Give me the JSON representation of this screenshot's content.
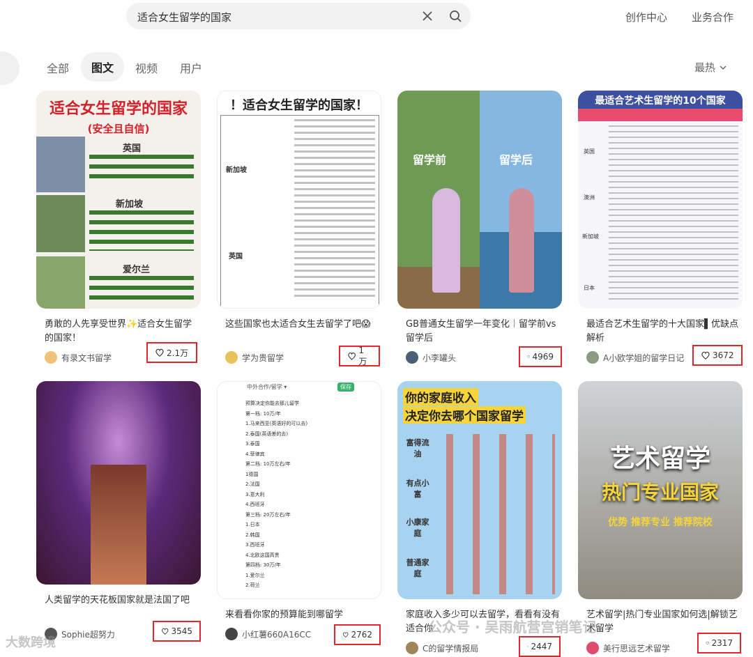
{
  "header": {
    "search_query": "适合女生留学的国家",
    "links": [
      "创作中心",
      "业务合作"
    ]
  },
  "tabs": [
    {
      "label": "全部",
      "active": false
    },
    {
      "label": "图文",
      "active": true
    },
    {
      "label": "视频",
      "active": false
    },
    {
      "label": "用户",
      "active": false
    }
  ],
  "sort_label": "最热",
  "cards": [
    {
      "thumb": {
        "headline": "适合女生留学的国家",
        "sub": "(安全且自信)",
        "sections": [
          "英国",
          "新加坡",
          "爱尔兰"
        ]
      },
      "title": "勇敢的人先享受世界✨适合女生留学的国家！",
      "author": "有录文书留学",
      "likes": "2.1万"
    },
    {
      "thumb": {
        "headline": "！适合女生留学的国家！",
        "rows": [
          "新加坡",
          "英国"
        ]
      },
      "title": "这些国家也太适合女生去留学了吧😱",
      "author": "学为贵留学",
      "likes": "1万"
    },
    {
      "thumb": {
        "left": "留学前",
        "right": "留学后"
      },
      "title": "GB普通女生留学一年变化｜留学前vs留学后",
      "author": "小李罐头",
      "likes": "4969"
    },
    {
      "thumb": {
        "headline": "最适合艺术生留学的10个国家",
        "countries": [
          "英国",
          "澳洲",
          "新加坡",
          "日本"
        ]
      },
      "title": "最适合艺术生留学的十大国家▌优缺点解析",
      "author": "A小欧学姐的留学日记",
      "likes": "3672"
    },
    {
      "thumb": {},
      "title": "人类留学的天花板国家就是法国了吧",
      "author": "Sophie超努力",
      "likes": "3545"
    },
    {
      "thumb": {
        "header": "中外合作/留学 ▾",
        "badge": "保存",
        "lines": [
          "预算决定你能去那儿留学",
          "第一档: 10万/年",
          "1.马来西亚(英语好的可以去)",
          "2.泰国(英语差的去)",
          "3.泰国",
          "4.菲律宾",
          "第二档: 10万左右/年",
          "1德国",
          "2.法国",
          "3.意大利",
          "4.西班牙",
          "第三档: 20万左右/年",
          "1.日本",
          "2.韩国",
          "3.西班牙",
          "4.北欧这国高贵",
          "第四档: 30万/年",
          "1.爱尔兰",
          "2.荷兰"
        ]
      },
      "title": "来看看你家的预算能到哪留学",
      "author": "小红薯660A16CC",
      "likes": "2762"
    },
    {
      "thumb": {
        "line1": "你的家庭收入",
        "line2": "决定你去哪个国家留学",
        "tiers": [
          "富得流油",
          "有点小富",
          "小康家庭",
          "普通家庭"
        ]
      },
      "title": "家庭收入多少可以去留学，看看有没有适合你",
      "author": "C的留学情报局",
      "likes": "2447"
    },
    {
      "thumb": {
        "line1": "艺术留学",
        "line2": "热门专业国家",
        "line3": "优势 推荐专业 推荐院校"
      },
      "title": "艺术留学|热门专业国家如何选|解锁艺术留学",
      "author": "美行思远艺术留学",
      "likes": "2317"
    }
  ],
  "watermark_text": "公众号 · 吴雨航营宫销笔记",
  "watermark_logo_text": "大数跨境",
  "colors": {
    "accent": "#e0262a",
    "tab_bg": "#f2f2f2"
  }
}
